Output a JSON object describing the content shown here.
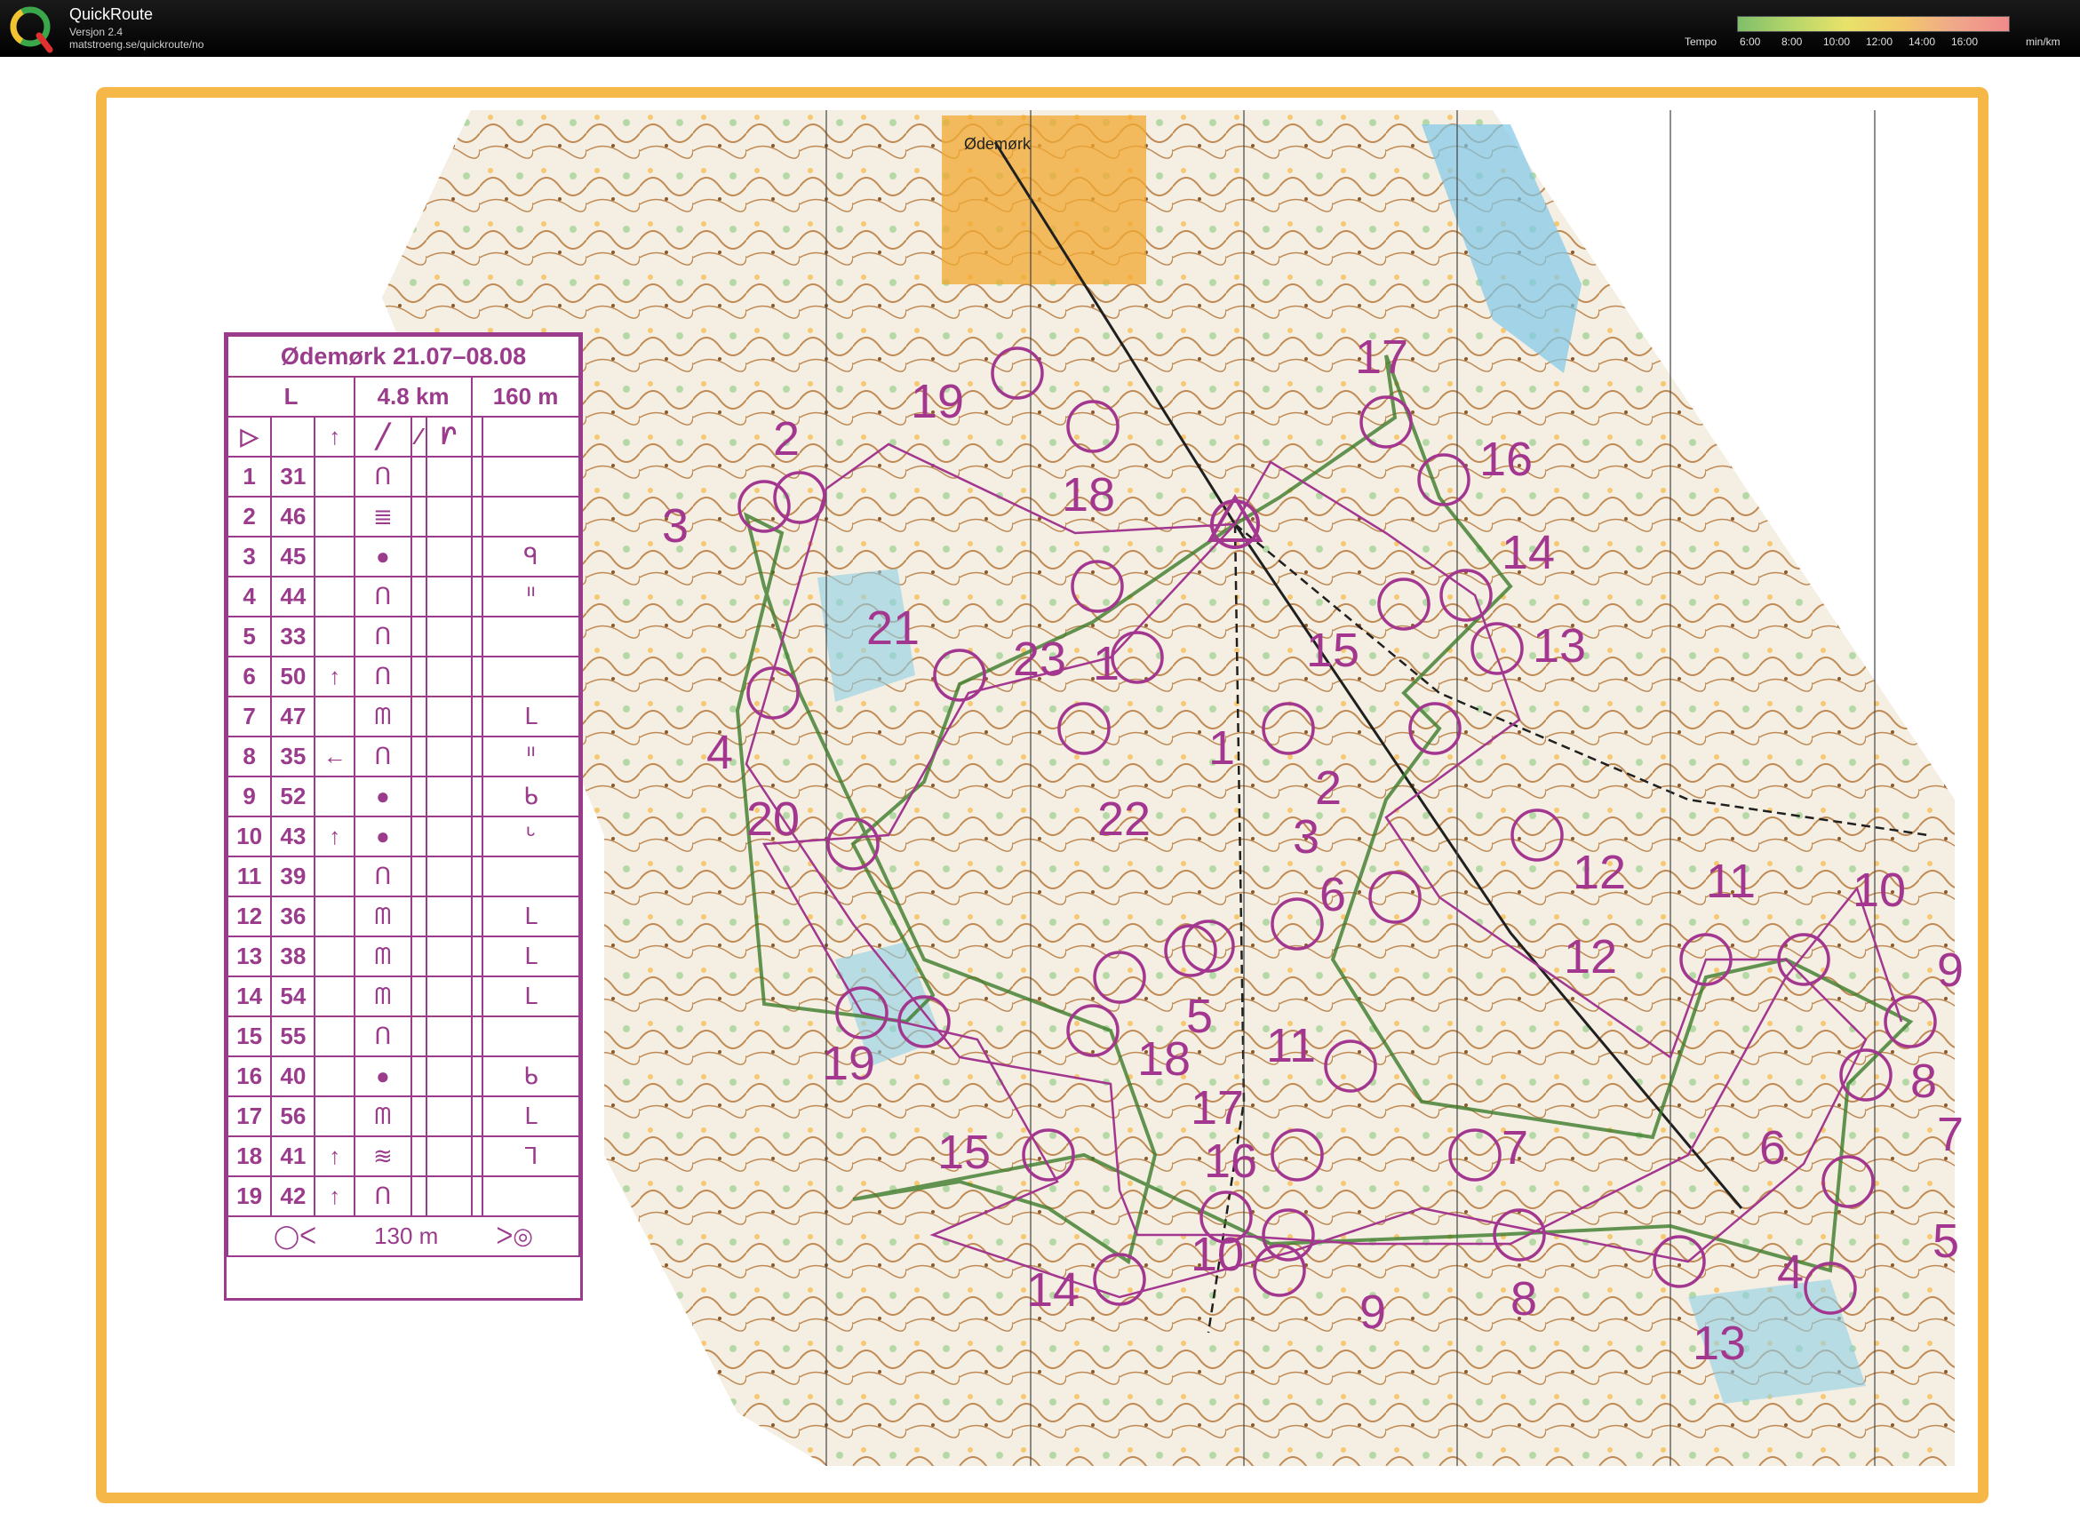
{
  "app": {
    "title": "QuickRoute",
    "version": "Versjon 2.4",
    "url": "matstroeng.se/quickroute/no"
  },
  "tempo": {
    "label": "Tempo",
    "ticks": [
      "6:00",
      "8:00",
      "10:00",
      "12:00",
      "14:00",
      "16:00"
    ],
    "unit": "min/km"
  },
  "map": {
    "place_name": "Ødemørk",
    "course_color": "#a3368f",
    "route_color": "#3c7a2a",
    "frame_color": "#f5b848",
    "course_a_numbers": [
      "1",
      "2",
      "3",
      "4",
      "5",
      "6",
      "7",
      "8",
      "9",
      "10",
      "11",
      "12",
      "13",
      "14",
      "15",
      "16",
      "17",
      "18",
      "19",
      "20",
      "21",
      "22",
      "23"
    ],
    "course_b_numbers": [
      "1",
      "2",
      "3",
      "4",
      "5",
      "6",
      "7",
      "8",
      "9",
      "10",
      "11",
      "12",
      "13",
      "14",
      "15",
      "16",
      "17",
      "18",
      "19"
    ]
  },
  "control_description": {
    "title": "Ødemørk 21.07–08.08",
    "class": "L",
    "length": "4.8 km",
    "climb": "160 m",
    "start_symbol": "▷",
    "finish_distance": "130 m",
    "rows": [
      {
        "n": "1",
        "code": "31",
        "dir": "",
        "feature": "ᑎ",
        "note": ""
      },
      {
        "n": "2",
        "code": "46",
        "dir": "",
        "feature": "≣",
        "note": ""
      },
      {
        "n": "3",
        "code": "45",
        "dir": "",
        "feature": "●",
        "note": "ᑫ"
      },
      {
        "n": "4",
        "code": "44",
        "dir": "",
        "feature": "ᑎ",
        "note": "ᑊᑊ"
      },
      {
        "n": "5",
        "code": "33",
        "dir": "",
        "feature": "ᑎ",
        "note": ""
      },
      {
        "n": "6",
        "code": "50",
        "dir": "↑",
        "feature": "ᑎ",
        "note": ""
      },
      {
        "n": "7",
        "code": "47",
        "dir": "",
        "feature": "ᗰ",
        "note": "ᒪ"
      },
      {
        "n": "8",
        "code": "35",
        "dir": "←",
        "feature": "ᑎ",
        "note": "ᑊᑊ"
      },
      {
        "n": "9",
        "code": "52",
        "dir": "",
        "feature": "●",
        "note": "ᑲ"
      },
      {
        "n": "10",
        "code": "43",
        "dir": "↑",
        "feature": "●",
        "note": "ᒡ"
      },
      {
        "n": "11",
        "code": "39",
        "dir": "",
        "feature": "ᑎ",
        "note": ""
      },
      {
        "n": "12",
        "code": "36",
        "dir": "",
        "feature": "ᗰ",
        "note": "ᒪ"
      },
      {
        "n": "13",
        "code": "38",
        "dir": "",
        "feature": "ᗰ",
        "note": "ᒪ"
      },
      {
        "n": "14",
        "code": "54",
        "dir": "",
        "feature": "ᗰ",
        "note": "ᒪ"
      },
      {
        "n": "15",
        "code": "55",
        "dir": "",
        "feature": "ᑎ",
        "note": ""
      },
      {
        "n": "16",
        "code": "40",
        "dir": "",
        "feature": "●",
        "note": "ᑲ"
      },
      {
        "n": "17",
        "code": "56",
        "dir": "",
        "feature": "ᗰ",
        "note": "ᒪ"
      },
      {
        "n": "18",
        "code": "41",
        "dir": "↑",
        "feature": "≋",
        "note": "ᒣ"
      },
      {
        "n": "19",
        "code": "42",
        "dir": "↑",
        "feature": "ᑎ",
        "note": ""
      }
    ]
  }
}
